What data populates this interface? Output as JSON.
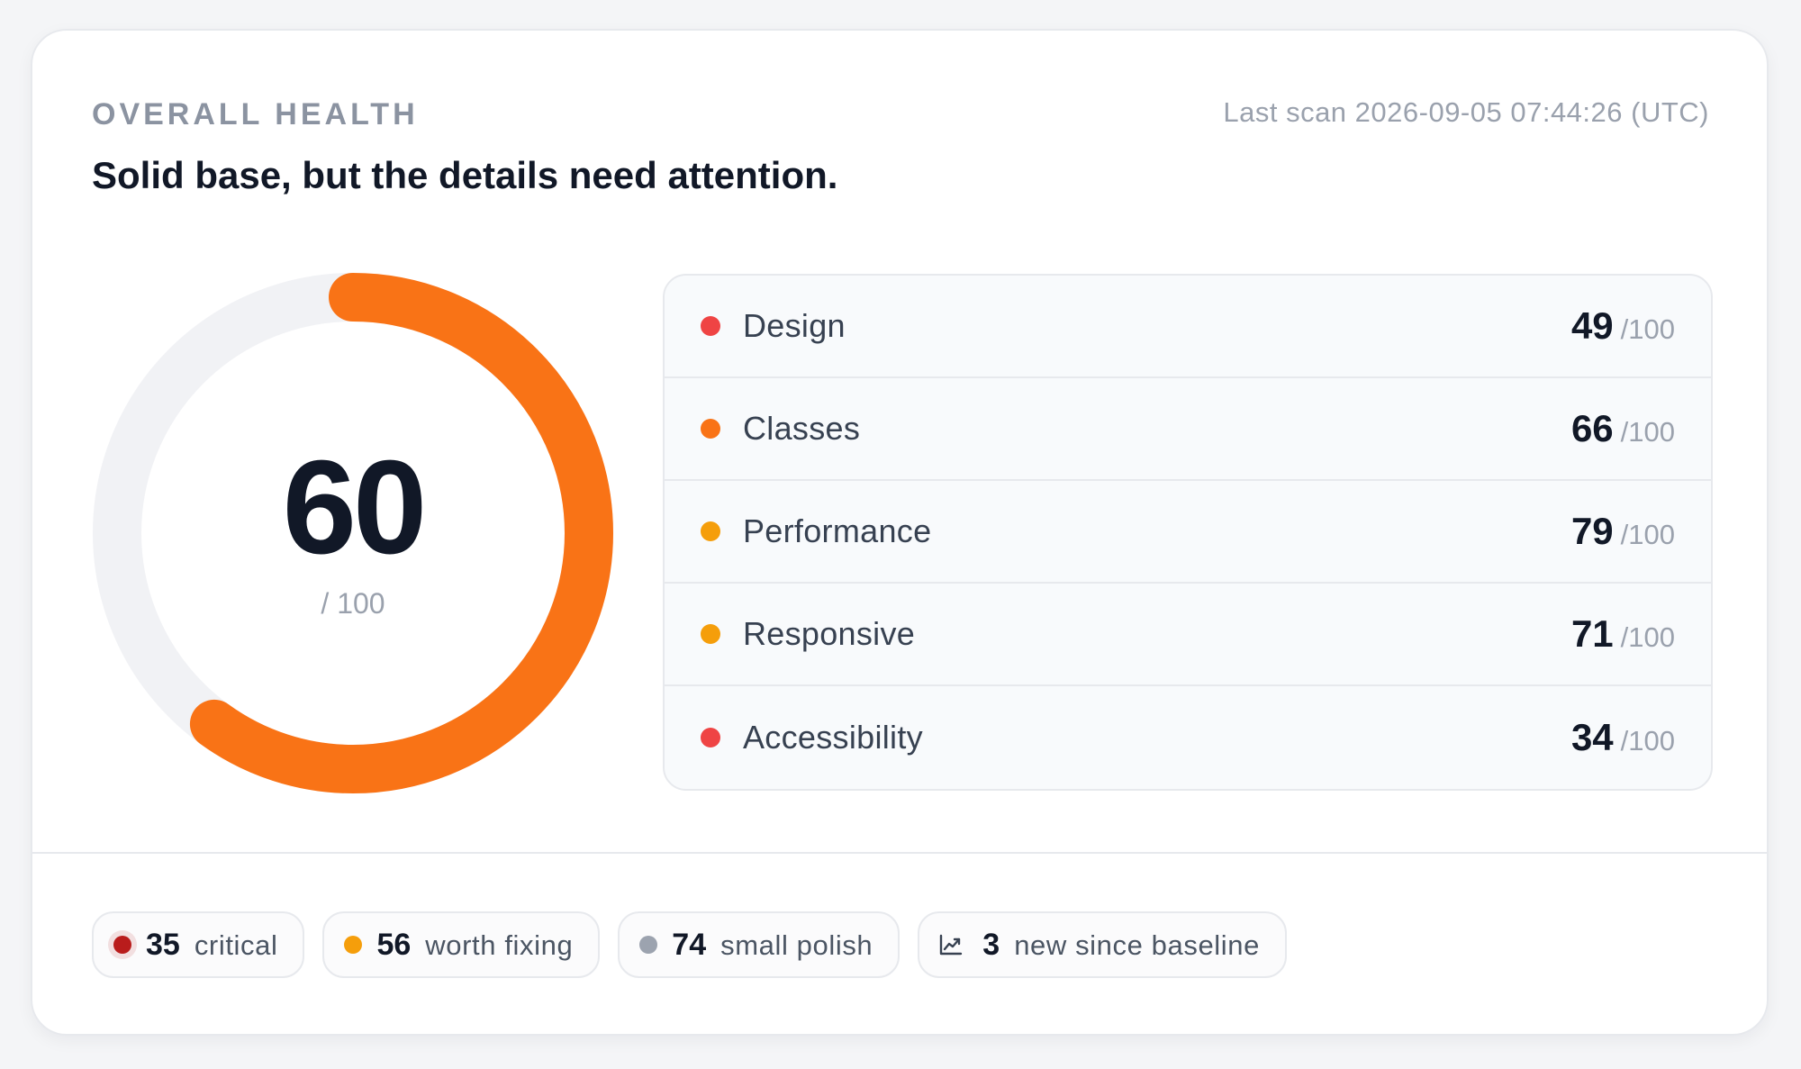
{
  "header": {
    "eyebrow": "OVERALL HEALTH",
    "headline": "Solid base, but the details need attention.",
    "last_scan": "Last scan 2026-09-05 07:44:26 (UTC)"
  },
  "gauge": {
    "score": "60",
    "max_label": "/ 100",
    "fraction": 0.6,
    "track_color": "#f1f2f5",
    "fill_color": "#f97316"
  },
  "categories": [
    {
      "name": "Design",
      "score": "49",
      "max": "/100",
      "dot_color": "#ef4444"
    },
    {
      "name": "Classes",
      "score": "66",
      "max": "/100",
      "dot_color": "#f97316"
    },
    {
      "name": "Performance",
      "score": "79",
      "max": "/100",
      "dot_color": "#f59e0b"
    },
    {
      "name": "Responsive",
      "score": "71",
      "max": "/100",
      "dot_color": "#f59e0b"
    },
    {
      "name": "Accessibility",
      "score": "34",
      "max": "/100",
      "dot_color": "#ef4444"
    }
  ],
  "summary": {
    "critical": {
      "count": "35",
      "label": "critical",
      "dot_color": "#b91c1c"
    },
    "worth_fixing": {
      "count": "56",
      "label": "worth fixing",
      "dot_color": "#f59e0b"
    },
    "small_polish": {
      "count": "74",
      "label": "small polish",
      "dot_color": "#9ca3af"
    },
    "new_since_baseline": {
      "count": "3",
      "label": "new since baseline",
      "icon": "trend-chart-icon"
    }
  }
}
